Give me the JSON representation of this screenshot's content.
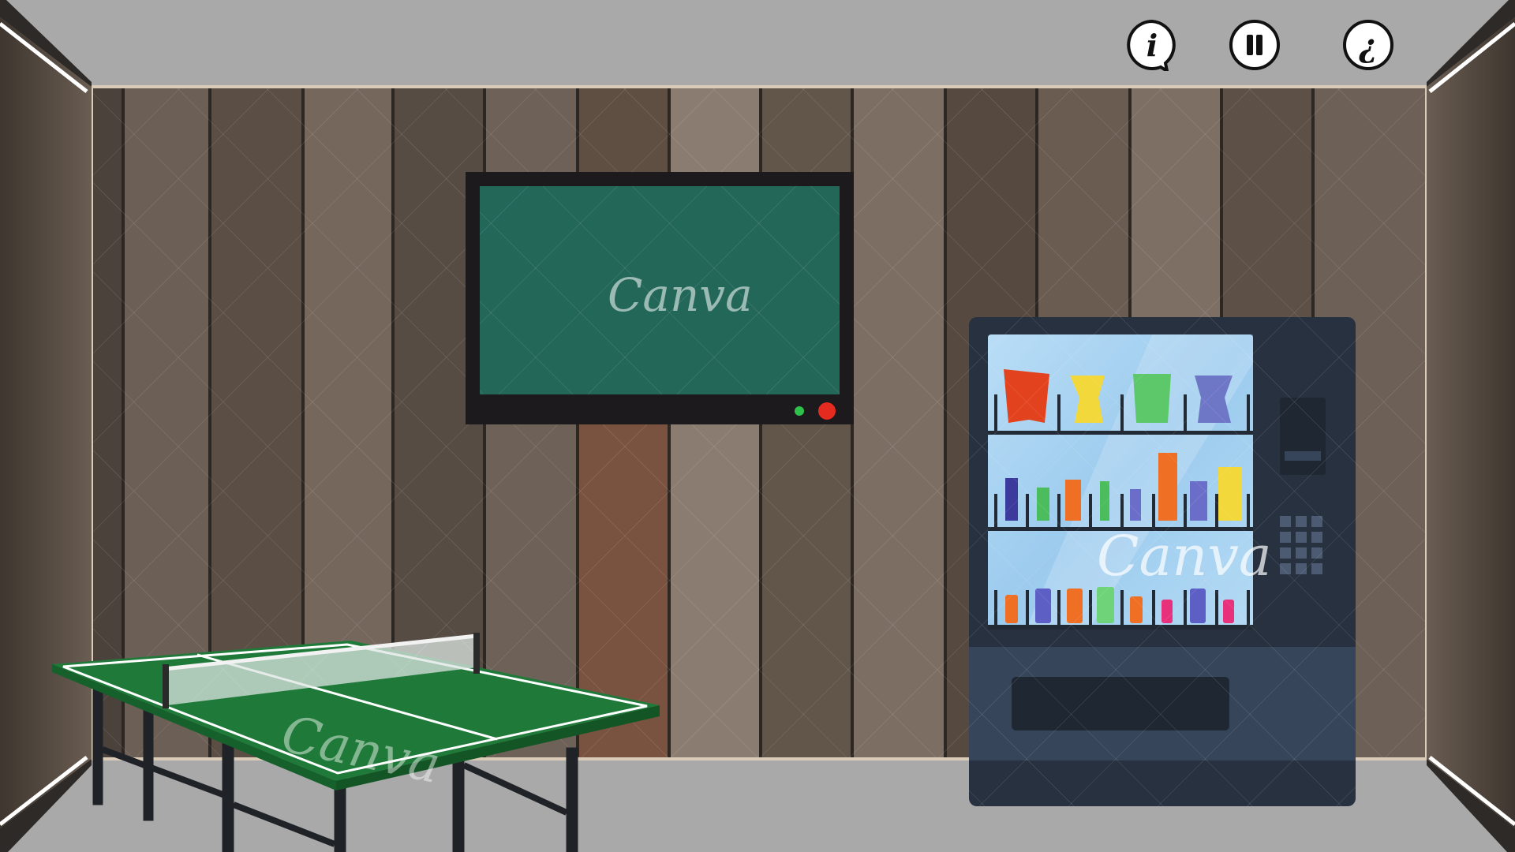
{
  "scene": {
    "watermark_text": "Canva",
    "colors": {
      "ceiling": "#a9a9a9",
      "floor": "#a9a9a9",
      "wood_dark": "#4a4038",
      "wood_light": "#8a7b6e",
      "tv_frame": "#1c1a1c",
      "tv_screen": "#236759",
      "table_green": "#1f7a3a",
      "vending_body": "#27313f",
      "vending_glass": "#a8d4f2"
    }
  },
  "hud": {
    "info_icon": "info-speech-icon",
    "pause_icon": "pause-icon",
    "help_icon": "inverted-question-icon",
    "info_glyph": "i",
    "pause_glyph": "",
    "help_glyph": "¿"
  },
  "tv": {
    "screen_watermark": "Canva",
    "power_led": "#2fc24a",
    "power_button": "#e52b1f"
  },
  "vending_machine": {
    "watermark": "Canva"
  },
  "ping_pong_table": {
    "watermark": "Canva"
  }
}
